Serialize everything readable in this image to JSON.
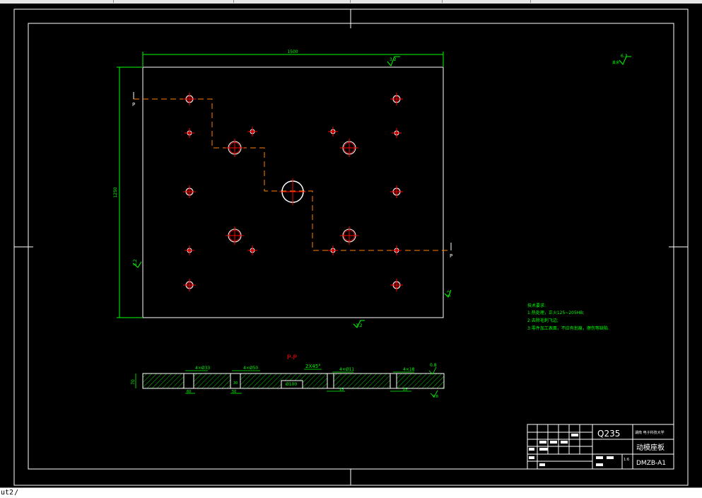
{
  "drawing": {
    "dim_width": "1500",
    "dim_height": "1250",
    "rough_top": "3.2",
    "rough_left": "3.2",
    "rough_bottom": "3.2",
    "rough_right": "3.2",
    "rough_general_label": "其余",
    "rough_general": "6.3",
    "section_mark": "P",
    "section_title": "P-P",
    "section_dims": {
      "d1": "4×Ø33",
      "d2": "4×Ø50",
      "d3": "2X45°",
      "d4": "4×Ø11",
      "d5": "4×18",
      "rough": "0.8",
      "thickness": "70",
      "bore": "Ø100",
      "s1": "60",
      "s2": "30",
      "s3": "50",
      "s4": "15",
      "s5": "25",
      "s6": "0.8"
    },
    "tech_req": {
      "title": "技术要求:",
      "lines": [
        "1:热处理，正火125~205HB;",
        "2:去除毛刺飞边;",
        "3:零件加工表面，不应有划痕，擦伤等缺陷."
      ]
    },
    "title_block": {
      "material": "Q235",
      "school": "湖南 电子科技大学",
      "part_name": "动模座板",
      "code": "DMZB-A1",
      "scale": "1:6"
    }
  },
  "command": {
    "text": "ut2"
  },
  "colors": {
    "frame": "#ffffff",
    "dim": "#00ff00",
    "hole": "#ff0000",
    "section_line": "#ff8000",
    "hatch": "#00ff00"
  }
}
